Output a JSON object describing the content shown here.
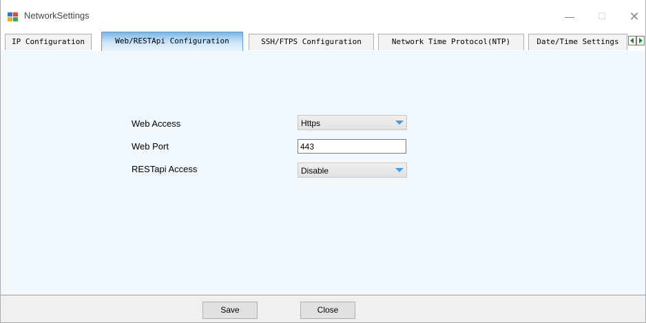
{
  "window": {
    "title": "NetworkSettings",
    "minimize_glyph": "—",
    "maximize_glyph": "☐",
    "close_glyph": "✕"
  },
  "tabs": [
    {
      "label": "IP Configuration",
      "active": false
    },
    {
      "label": "Web/RESTApi Configuration",
      "active": true
    },
    {
      "label": "SSH/FTPS Configuration",
      "active": false
    },
    {
      "label": "Network Time Protocol(NTP)",
      "active": false
    },
    {
      "label": "Date/Time Settings",
      "active": false
    }
  ],
  "form": {
    "web_access": {
      "label": "Web Access",
      "value": "Https"
    },
    "web_port": {
      "label": "Web Port",
      "value": "443"
    },
    "restapi_access": {
      "label": "RESTapi Access",
      "value": "Disable"
    }
  },
  "footer": {
    "save_label": "Save",
    "close_label": "Close"
  },
  "colors": {
    "panel_background": "#f1f8fd",
    "active_tab_accent": "#7ab6e5",
    "dropdown_arrow": "#3c9ee8",
    "scroll_arrow": "#1a8a1a"
  },
  "icons": {
    "app": "network-settings-app-icon",
    "dropdown": "chevron-down-icon",
    "tab_left": "tab-scroll-left-icon",
    "tab_right": "tab-scroll-right-icon"
  }
}
